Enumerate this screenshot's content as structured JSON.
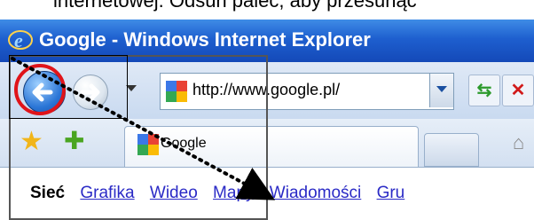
{
  "doc_text": "internetowej. Odsuń palec, aby przesunąć",
  "window": {
    "title": "Google - Windows Internet Explorer"
  },
  "navbar": {
    "url": "http://www.google.pl/",
    "icons": [
      "back-icon",
      "forward-icon",
      "refresh-icon",
      "stop-icon"
    ]
  },
  "tabbar": {
    "tab_label": "Google",
    "icons": [
      "favorites-star-icon",
      "add-favorite-icon",
      "new-tab-icon",
      "home-icon"
    ]
  },
  "gbar": {
    "active": "Sieć",
    "links": [
      "Grafika",
      "Wideo",
      "Mapy",
      "Wiadomości",
      "Gru"
    ]
  },
  "colors": {
    "titlebar": "#1e5fcf",
    "highlight_ring": "#e0141a",
    "link": "#2a2ac6"
  }
}
